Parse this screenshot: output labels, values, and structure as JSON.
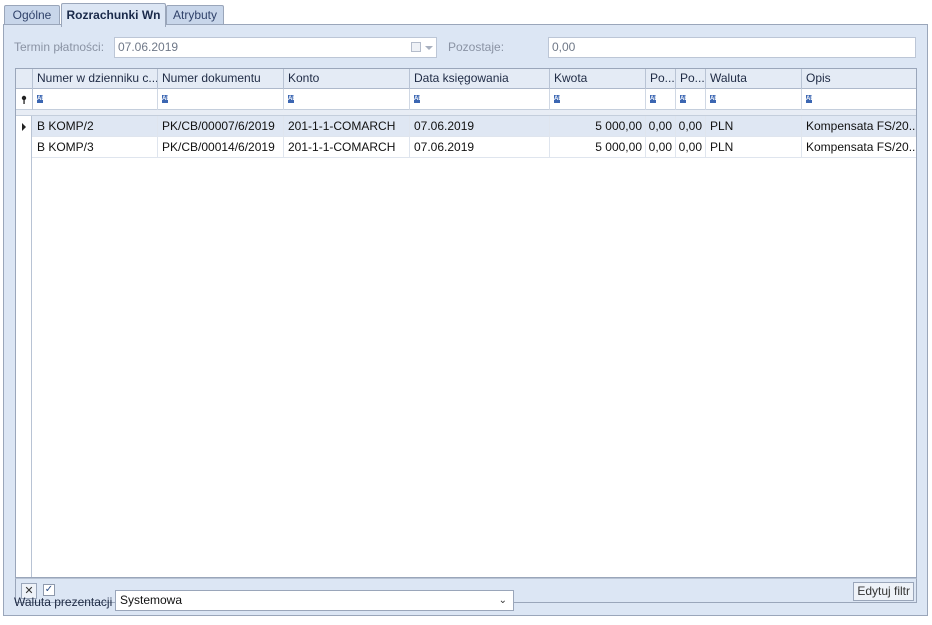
{
  "tabs": [
    {
      "label": "Ogólne"
    },
    {
      "label": "Rozrachunki Wn"
    },
    {
      "label": "Atrybuty"
    }
  ],
  "form": {
    "termin_label": "Termin płatności:",
    "termin_value": "07.06.2019",
    "pozostaje_label": "Pozostaje:",
    "pozostaje_value": "0,00"
  },
  "grid": {
    "columns": [
      "Numer w dzienniku c...",
      "Numer dokumentu",
      "Konto",
      "Data księgowania",
      "Kwota",
      "Po...",
      "Po...",
      "Waluta",
      "Opis"
    ],
    "filter_icon": "abc-filter-icon",
    "filter_text": "ABC",
    "rows": [
      {
        "numer_dziennik": "B KOMP/2",
        "numer_dokumentu": "PK/CB/00007/6/2019",
        "konto": "201-1-1-COMARCH",
        "data": "07.06.2019",
        "kwota": "5 000,00",
        "po1": "0,00",
        "po2": "0,00",
        "waluta": "PLN",
        "opis": "Kompensata FS/20..."
      },
      {
        "numer_dziennik": "B KOMP/3",
        "numer_dokumentu": "PK/CB/00014/6/2019",
        "konto": "201-1-1-COMARCH",
        "data": "07.06.2019",
        "kwota": "5 000,00",
        "po1": "0,00",
        "po2": "0,00",
        "waluta": "PLN",
        "opis": "Kompensata FS/20..."
      }
    ]
  },
  "footer": {
    "close_icon": "x-icon",
    "check_glyph": "✓",
    "edit_filter_label": "Edytuj filtr"
  },
  "bottom": {
    "waluta_label": "Waluta prezentacji",
    "waluta_value": "Systemowa"
  },
  "colors": {
    "panel_bg": "#dce6f4",
    "selected_row": "#dfe7f3",
    "tab_inactive": "#c8d6ea"
  }
}
